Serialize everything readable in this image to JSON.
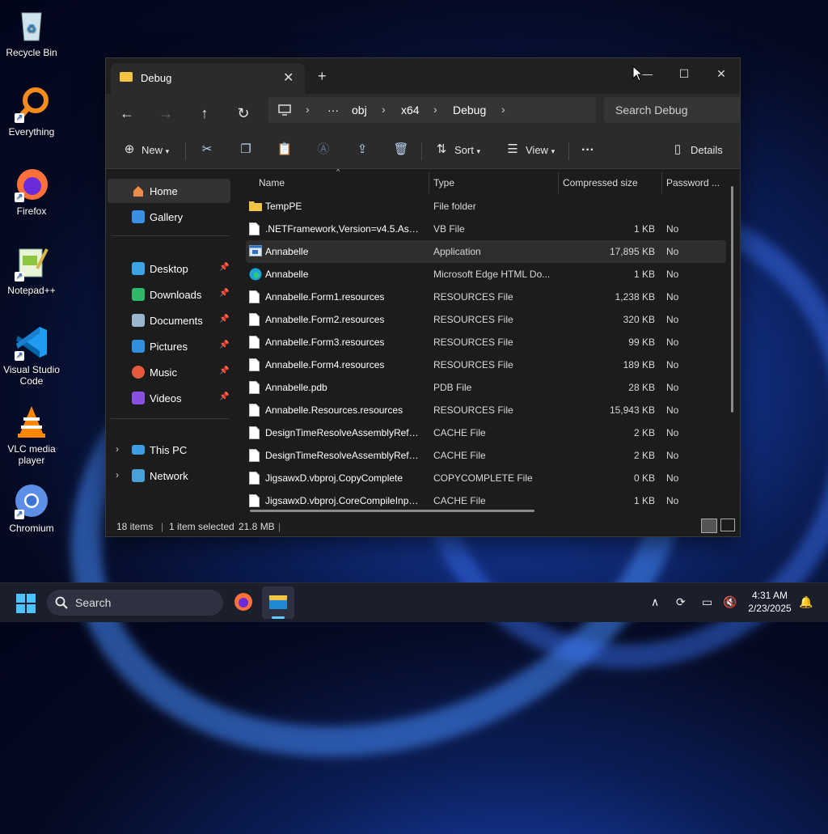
{
  "desktop": {
    "icons": [
      {
        "label": "Recycle Bin"
      },
      {
        "label": "Everything"
      },
      {
        "label": "Firefox"
      },
      {
        "label": "Notepad++"
      },
      {
        "label": "Visual Studio Code"
      },
      {
        "label": "VLC media player"
      },
      {
        "label": "Chromium"
      }
    ]
  },
  "window": {
    "tab_title": "Debug",
    "tab_close": "✕",
    "new_tab": "+",
    "controls": {
      "minimize": "—",
      "maximize": "☐",
      "close": "✕"
    },
    "nav": {
      "back": "←",
      "forward": "→",
      "up": "↑",
      "refresh": "↻"
    },
    "breadcrumb": [
      "obj",
      "x64",
      "Debug"
    ],
    "breadcrumb_more": "···",
    "search_placeholder": "Search Debug",
    "toolbar": {
      "new_label": "New",
      "sort_label": "Sort",
      "view_label": "View",
      "more_label": "···",
      "details_label": "Details"
    },
    "sidebar": {
      "top": [
        {
          "label": "Home",
          "selected": true
        },
        {
          "label": "Gallery"
        }
      ],
      "pinned": [
        {
          "label": "Desktop"
        },
        {
          "label": "Downloads"
        },
        {
          "label": "Documents"
        },
        {
          "label": "Pictures"
        },
        {
          "label": "Music"
        },
        {
          "label": "Videos"
        }
      ],
      "tree": [
        {
          "label": "This PC"
        },
        {
          "label": "Network"
        }
      ]
    },
    "columns": {
      "name": "Name",
      "type": "Type",
      "size": "Compressed size",
      "password": "Password ..."
    },
    "files": [
      {
        "name": "TempPE",
        "type": "File folder",
        "size": "",
        "password": "",
        "icon": "folder-icon"
      },
      {
        "name": ".NETFramework,Version=v4.5.Asse...",
        "type": "VB File",
        "size": "1 KB",
        "password": "No",
        "icon": "file-icon"
      },
      {
        "name": "Annabelle",
        "type": "Application",
        "size": "17,895 KB",
        "password": "No",
        "icon": "app-icon"
      },
      {
        "name": "Annabelle",
        "type": "Microsoft Edge HTML Do...",
        "size": "1 KB",
        "password": "No",
        "icon": "edge-icon"
      },
      {
        "name": "Annabelle.Form1.resources",
        "type": "RESOURCES File",
        "size": "1,238 KB",
        "password": "No",
        "icon": "file-icon"
      },
      {
        "name": "Annabelle.Form2.resources",
        "type": "RESOURCES File",
        "size": "320 KB",
        "password": "No",
        "icon": "file-icon"
      },
      {
        "name": "Annabelle.Form3.resources",
        "type": "RESOURCES File",
        "size": "99 KB",
        "password": "No",
        "icon": "file-icon"
      },
      {
        "name": "Annabelle.Form4.resources",
        "type": "RESOURCES File",
        "size": "189 KB",
        "password": "No",
        "icon": "file-icon"
      },
      {
        "name": "Annabelle.pdb",
        "type": "PDB File",
        "size": "28 KB",
        "password": "No",
        "icon": "file-icon"
      },
      {
        "name": "Annabelle.Resources.resources",
        "type": "RESOURCES File",
        "size": "15,943 KB",
        "password": "No",
        "icon": "file-icon"
      },
      {
        "name": "DesignTimeResolveAssemblyRefer...",
        "type": "CACHE File",
        "size": "2 KB",
        "password": "No",
        "icon": "file-icon"
      },
      {
        "name": "DesignTimeResolveAssemblyRefer...",
        "type": "CACHE File",
        "size": "2 KB",
        "password": "No",
        "icon": "file-icon"
      },
      {
        "name": "JigsawxD.vbproj.CopyComplete",
        "type": "COPYCOMPLETE File",
        "size": "0 KB",
        "password": "No",
        "icon": "file-icon"
      },
      {
        "name": "JigsawxD.vbproj.CoreCompileInput...",
        "type": "CACHE File",
        "size": "1 KB",
        "password": "No",
        "icon": "file-icon"
      }
    ],
    "status": {
      "items": "18 items",
      "selected": "1 item selected",
      "size": "21.8 MB"
    }
  },
  "taskbar": {
    "search_label": "Search",
    "time": "4:31 AM",
    "date": "2/23/2025"
  },
  "colors": {
    "accent": "#0078d4",
    "folder": "#f4c542"
  }
}
